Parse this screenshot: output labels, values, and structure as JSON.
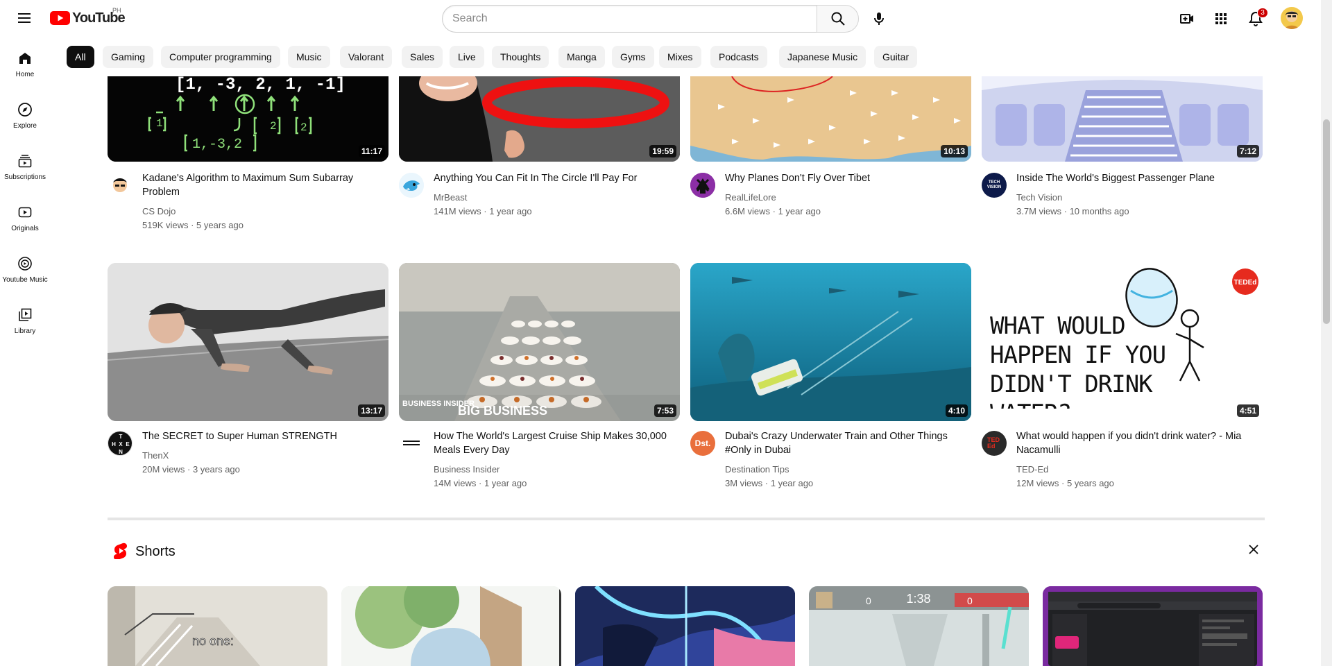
{
  "header": {
    "logo_text": "YouTube",
    "country_code": "PH",
    "search_placeholder": "Search",
    "notification_count": "3"
  },
  "sidebar": {
    "items": [
      {
        "label": "Home",
        "icon": "home-icon"
      },
      {
        "label": "Explore",
        "icon": "compass-icon"
      },
      {
        "label": "Subscriptions",
        "icon": "subscriptions-icon"
      },
      {
        "label": "Originals",
        "icon": "originals-icon"
      },
      {
        "label": "Youtube Music",
        "icon": "music-disc-icon"
      },
      {
        "label": "Library",
        "icon": "library-icon"
      }
    ]
  },
  "chips": [
    "All",
    "Gaming",
    "Computer programming",
    "Music",
    "Valorant",
    "Sales",
    "Live",
    "Thoughts",
    "Manga",
    "Gyms",
    "Mixes",
    "Podcasts",
    "Japanese Music",
    "Guitar"
  ],
  "videos": [
    {
      "title": "Kadane's Algorithm to Maximum Sum Subarray Problem",
      "channel": "CS Dojo",
      "meta": "519K views · 5 years ago",
      "duration": "11:17",
      "thumb_text": "[1, -3, 2, 1, -1]"
    },
    {
      "title": "Anything You Can Fit In The Circle I'll Pay For",
      "channel": "MrBeast",
      "meta": "141M views · 1 year ago",
      "duration": "19:59"
    },
    {
      "title": "Why Planes Don't Fly Over Tibet",
      "channel": "RealLifeLore",
      "meta": "6.6M views · 1 year ago",
      "duration": "10:13"
    },
    {
      "title": "Inside The World's Biggest Passenger Plane",
      "channel": "Tech Vision",
      "meta": "3.7M views · 10 months ago",
      "duration": "7:12",
      "avatar_text": "TECH VISION"
    },
    {
      "title": "The SECRET to Super Human STRENGTH",
      "channel": "ThenX",
      "meta": "20M views · 3 years ago",
      "duration": "13:17",
      "avatar_text": "T H E N X"
    },
    {
      "title": "How The World's Largest Cruise Ship Makes 30,000 Meals Every Day",
      "channel": "Business Insider",
      "meta": "14M views · 1 year ago",
      "duration": "7:53",
      "thumb_text": "BUSINESS INSIDER",
      "thumb_text2": "BIG BUSINESS"
    },
    {
      "title": "Dubai's Crazy Underwater Train and Other Things #Only in Dubai",
      "channel": "Destination Tips",
      "meta": "3M views · 1 year ago",
      "duration": "4:10",
      "avatar_text": "Dst."
    },
    {
      "title": "What would happen if you didn't drink water? - Mia Nacamulli",
      "channel": "TED-Ed",
      "meta": "12M views · 5 years ago",
      "duration": "4:51",
      "thumb_text": "WHAT WOULD HAPPEN IF YOU DIDN'T DRINK WATER?",
      "badge": "TEDEd",
      "avatar_text": "TED Ed"
    }
  ],
  "shorts": {
    "title": "Shorts",
    "items": [
      {
        "overlay": "no one:"
      },
      {
        "overlay": ""
      },
      {
        "overlay": ""
      },
      {
        "overlay": "1:38",
        "score_left": "0",
        "score_right": "0"
      },
      {
        "overlay": ""
      }
    ]
  },
  "colors": {
    "brand_red": "#ff0000",
    "text_primary": "#0f0f0f",
    "text_secondary": "#606060",
    "chip_bg": "#f2f2f2",
    "chip_active_bg": "#0f0f0f"
  }
}
